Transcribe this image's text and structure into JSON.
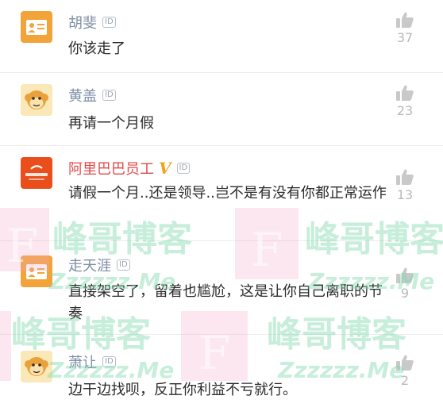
{
  "colors": {
    "username": "#7e8ea5",
    "vip_username": "#e2484a",
    "v_badge": "#f2a21c",
    "comment_text": "#2b2b2b",
    "like_count": "#b8b8b8",
    "watermark_green": "#7ad9a8",
    "watermark_pink": "#f3a9cc"
  },
  "comments": [
    {
      "name": "胡斐",
      "id_badge": "ID",
      "text": "你该走了",
      "likes": "37",
      "avatar": "id-card-icon"
    },
    {
      "name": "黄盖",
      "id_badge": "ID",
      "text": "再请一个月假",
      "likes": "23",
      "avatar": "monkey-avatar-icon"
    },
    {
      "name": "阿里巴巴员工",
      "v_badge": "V",
      "id_badge": "ID",
      "text": "请假一个月..还是领导..岂不是有没有你都正常运作",
      "likes": "13",
      "avatar": "alibaba-logo-icon"
    },
    {
      "name": "走天涯",
      "id_badge": "ID",
      "text": "直接架空了，留着也尴尬，这是让你自己离职的节奏",
      "likes": "9",
      "avatar": "id-card-icon"
    },
    {
      "name": "萧让",
      "id_badge": "ID",
      "text": "边干边找呗，反正你利益不亏就行。",
      "likes": "2",
      "avatar": "monkey-avatar-icon"
    }
  ],
  "watermark": {
    "brand": "峰哥博客",
    "domain": "Zzzzzz.Me",
    "letter": "F"
  }
}
